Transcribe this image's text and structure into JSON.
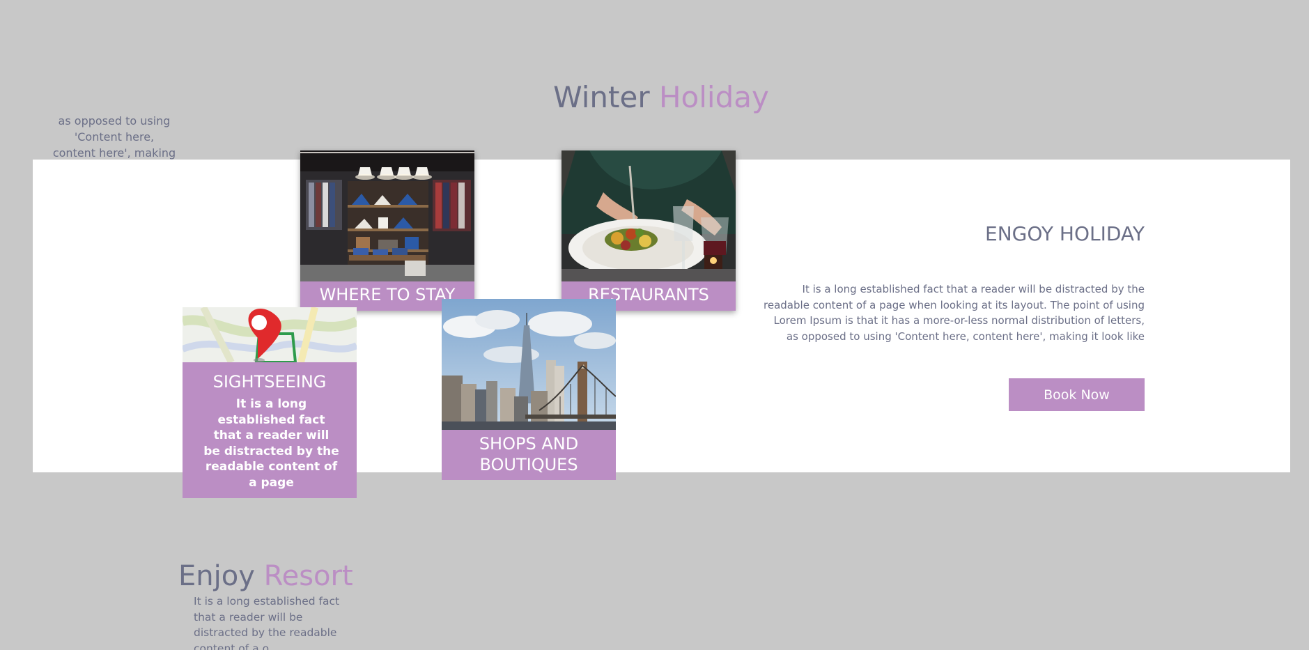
{
  "header": {
    "title_part1": "Winter",
    "title_part2": "Holiday"
  },
  "side_snippet": "as opposed to using 'Content here, content here', making it look lik",
  "feature": {
    "title": "ENGOY HOLIDAY",
    "text": "It is a long established fact that a reader will be distracted by the readable content of a page when looking at its layout. The point of using Lorem Ipsum is that it has a more-or-less normal distribution of letters, as opposed to using 'Content here, content here', making it look like",
    "button_label": "Book Now"
  },
  "cards": {
    "stay": {
      "label": "WHERE TO STAY",
      "image": "clothing-store-photo"
    },
    "restaurants": {
      "label": "RESTAURANTS",
      "image": "restaurant-dining-photo"
    },
    "sightseeing": {
      "label": "SIGHTSEEING",
      "description": "It is a long established fact that a reader will be distracted by the readable content of a page",
      "image": "map-pin-photo"
    },
    "shops": {
      "label": "SHOPS AND BOUTIQUES",
      "image": "city-skyline-photo"
    }
  },
  "resort": {
    "title_part1": "Enjoy",
    "title_part2": "Resort",
    "text": "It is a long established fact that a reader will be distracted by the readable content of a o"
  },
  "colors": {
    "background": "#c8c8c8",
    "panel": "#ffffff",
    "accent": "#bb8ec4",
    "text": "#6b6f87"
  }
}
